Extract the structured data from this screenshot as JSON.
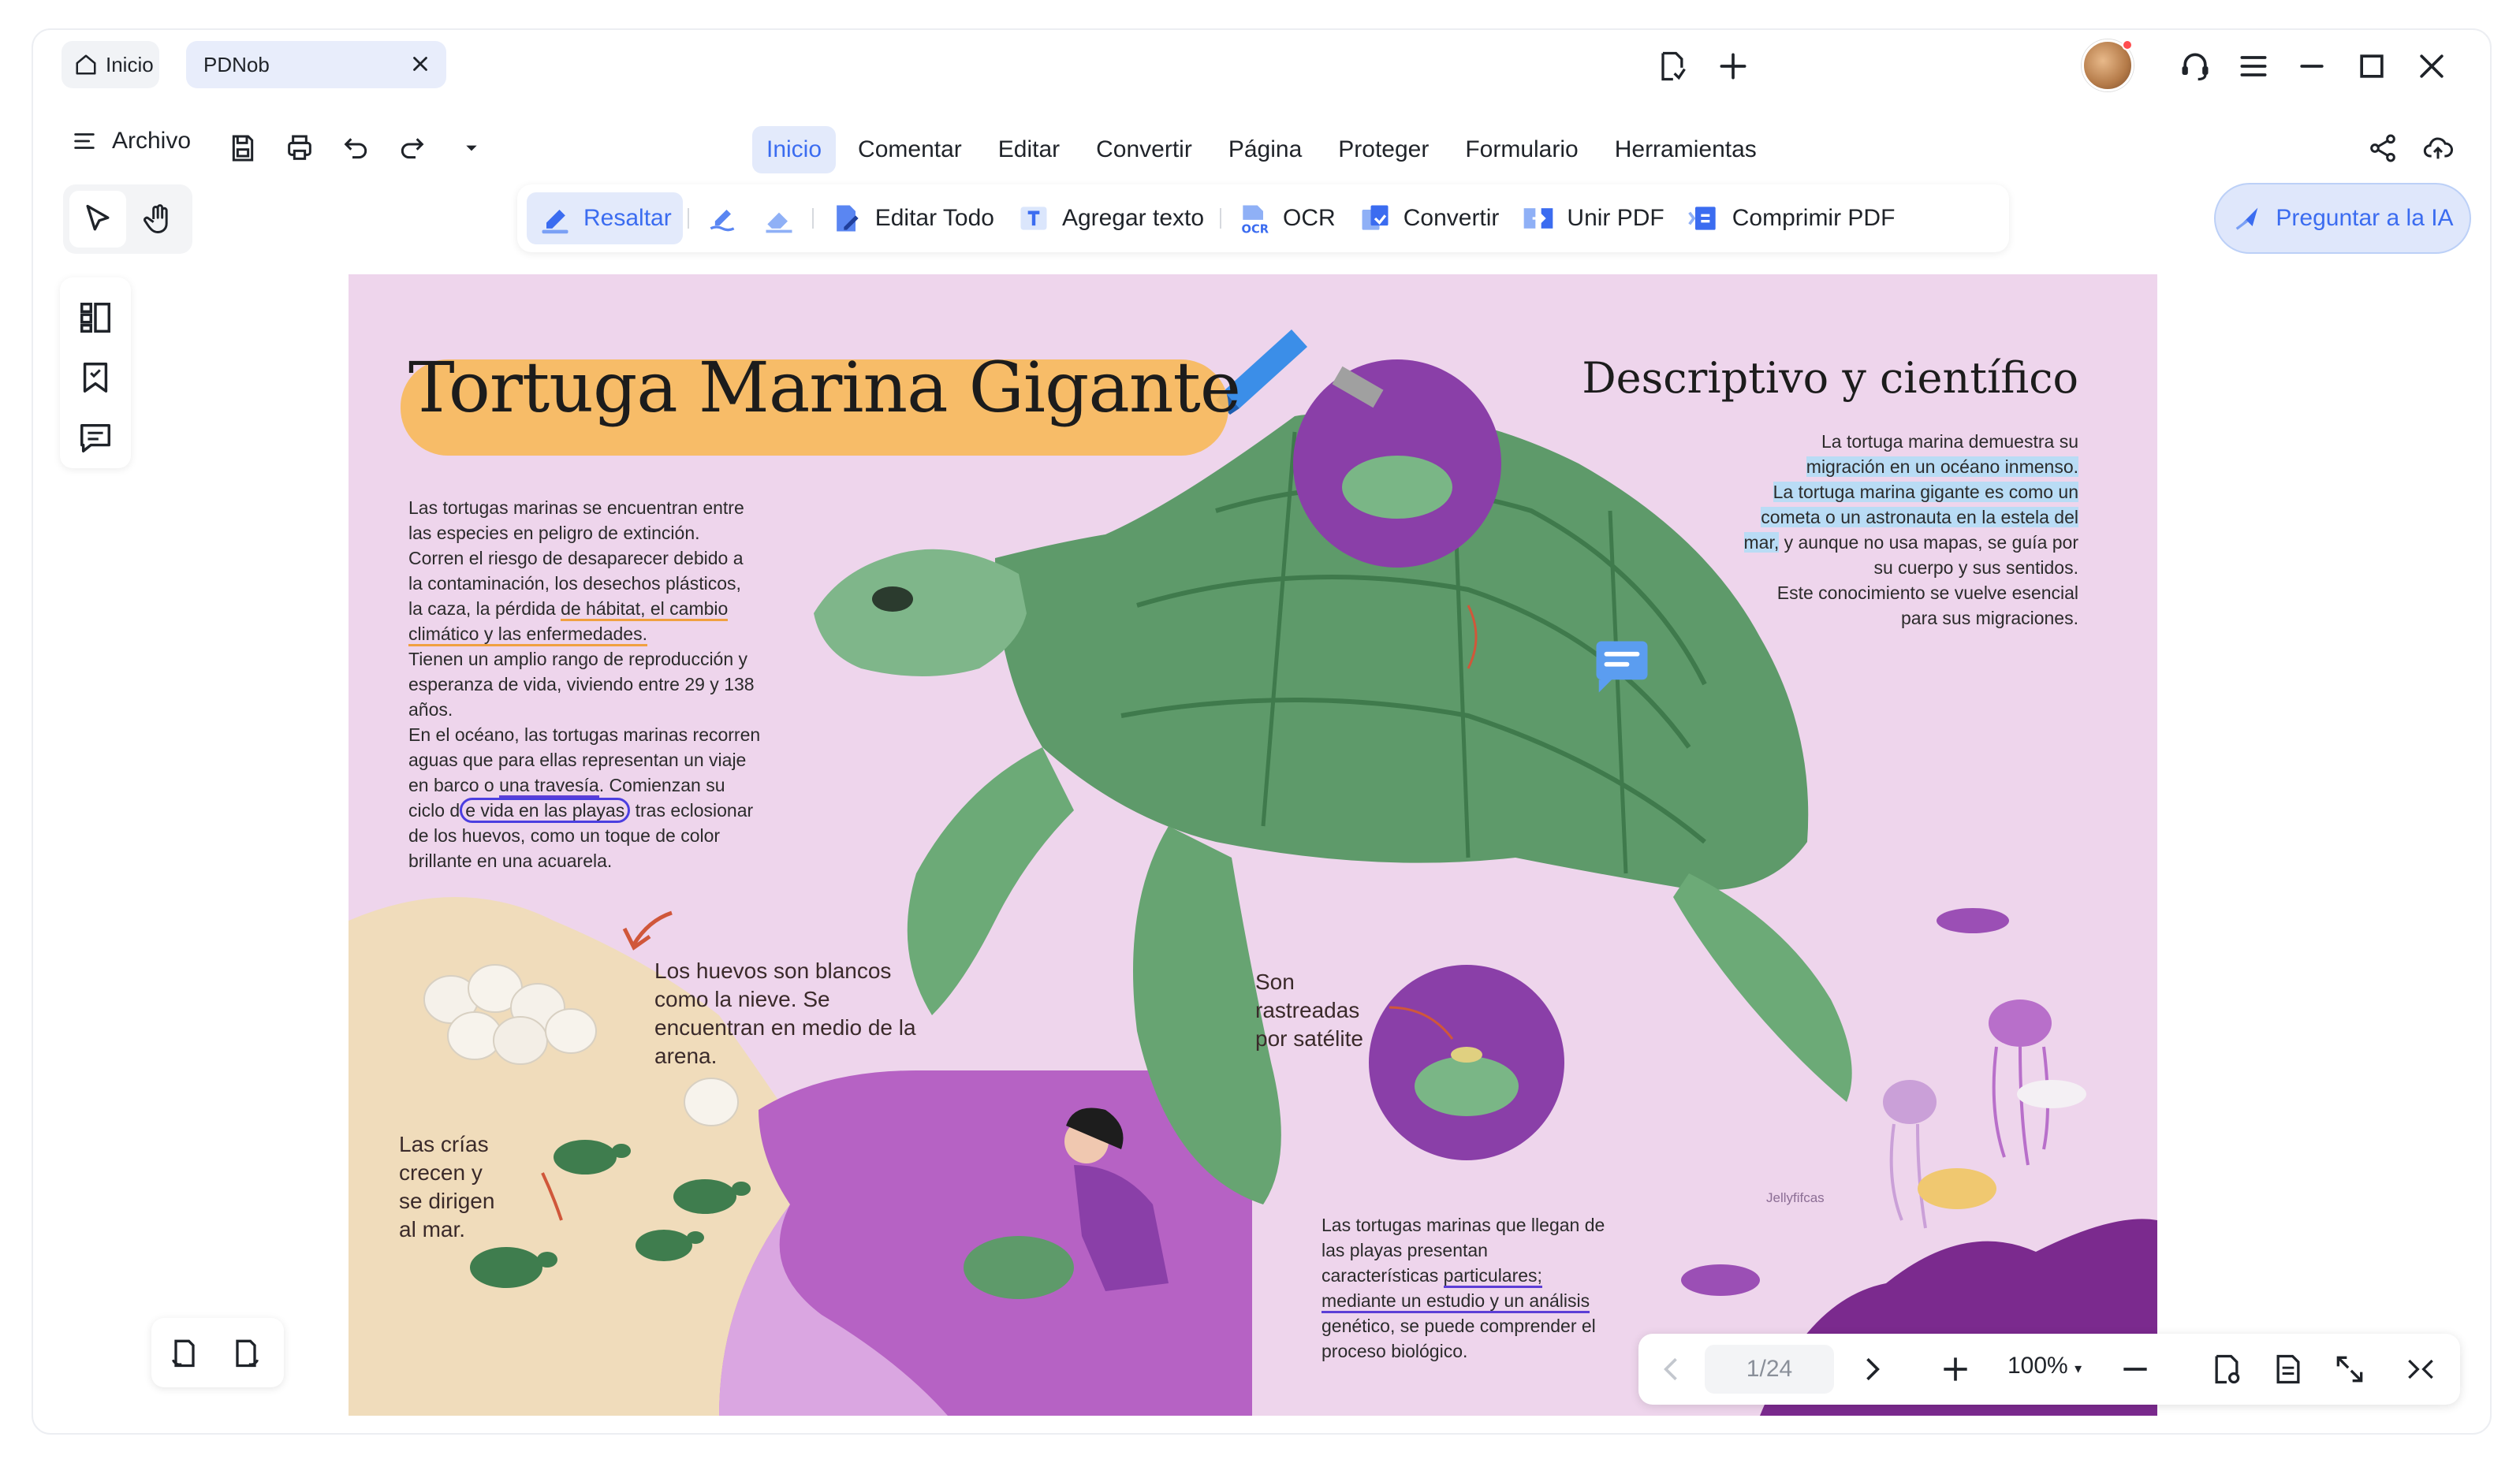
{
  "titlebar": {
    "home_tab": "Inicio",
    "doc_tab": "PDNob"
  },
  "menubar": {
    "file_label": "Archivo",
    "tabs": [
      "Inicio",
      "Comentar",
      "Editar",
      "Convertir",
      "Página",
      "Proteger",
      "Formulario",
      "Herramientas"
    ],
    "active_tab": "Inicio"
  },
  "toolbar": {
    "highlight": "Resaltar",
    "edit_all": "Editar Todo",
    "add_text": "Agregar texto",
    "ocr": "OCR",
    "convert": "Convertir",
    "merge": "Unir PDF",
    "compress": "Comprimir PDF",
    "ai_button": "Preguntar a la IA"
  },
  "document": {
    "title": "Tortuga Marina Gigante",
    "subtitle": "Descriptivo y científico",
    "left_paragraph": {
      "l1": "Las tortugas marinas se encuentran entre",
      "l2": "las especies en peligro de extinción.",
      "l3": "Corren el riesgo de desaparecer debido a",
      "l4": "la contaminación, los desechos plásticos,",
      "l5a": "la caza, la pérdida ",
      "l5b": "de hábitat, el cambio",
      "l6": "climático y las enfermedades.",
      "l7": "Tienen un amplio rango de reproducción y",
      "l8": "esperanza de vida, viviendo entre 29 y 138",
      "l9": "años.",
      "l10": "En el océano, las tortugas marinas recorren",
      "l11": "aguas que para ellas representan un viaje",
      "l12a": "en barco o ",
      "l12b": "una travesía",
      "l12c": ". Comienzan su",
      "l13a": "ciclo d",
      "l13b": "e vida en las playas",
      "l13c": " tras eclosionar",
      "l14": "de los huevos, como un toque de color",
      "l15": "brillante en una acuarela."
    },
    "right_paragraph": {
      "l1": "La tortuga marina demuestra su",
      "l2": "migración en un océano inmenso.",
      "l3": "La tortuga marina gigante es como un",
      "l4": "cometa o un astronauta en la estela del",
      "l5a": "mar,",
      "l5b": " y aunque no usa mapas, se guía por",
      "l6": "su cuerpo y sus sentidos.",
      "l7": "Este conocimiento se vuelve esencial",
      "l8": "para sus migraciones."
    },
    "bottom_paragraph": {
      "l1": "Las tortugas marinas que llegan de",
      "l2": "las playas presentan",
      "l3a": "características ",
      "l3b": "particulares;",
      "l4": "mediante un estudio y un análisis",
      "l5": "genético, se puede comprender el",
      "l6": "proceso biológico."
    },
    "note_eggs": [
      "Los huevos son blancos",
      "como la nieve. Se",
      "encuentran en medio de la",
      "arena."
    ],
    "note_babies": [
      "Las crías",
      "crecen y",
      "se dirigen",
      "al mar."
    ],
    "note_tracked": [
      "Son",
      "rastreadas",
      "por satélite"
    ],
    "jellyfish_label": "Jellyfifcas"
  },
  "pagenav": {
    "page": "1/24",
    "zoom": "100%"
  },
  "colors": {
    "accent": "#3b6cf0",
    "page_bg": "#eed5ec",
    "title_highlight": "#f7bb61",
    "turtle": "#6aa374",
    "purple": "#8a3fa8"
  }
}
